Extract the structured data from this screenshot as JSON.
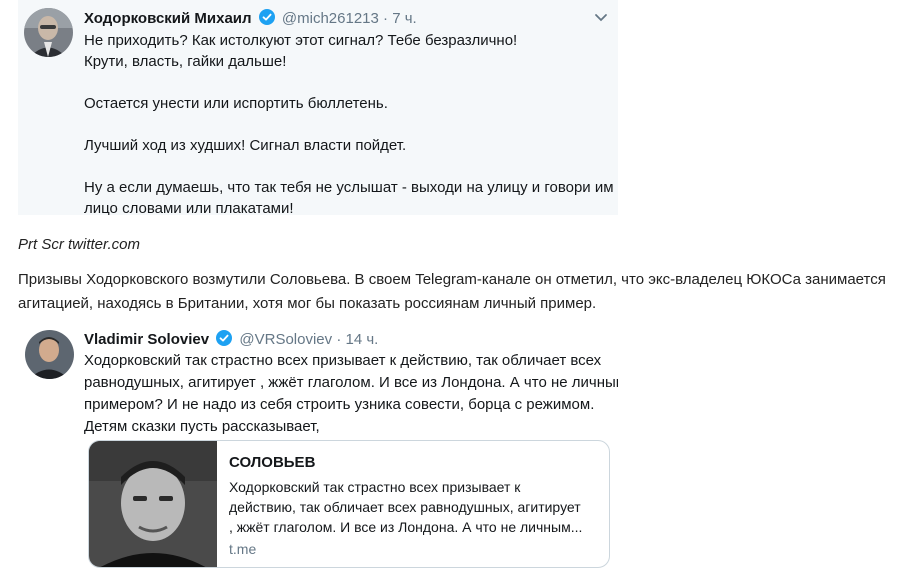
{
  "tweet1": {
    "name": "Ходорковский Михаил",
    "handle": "@mich261213",
    "dot": "·",
    "time": "7 ч.",
    "paragraphs": [
      [
        "Не приходить? Как истолкуют этот сигнал? Тебе безразлично!",
        "Крути, власть, гайки дальше!"
      ],
      [
        "Остается унести или испортить бюллетень."
      ],
      [
        "Лучший ход из худших! Сигнал власти пойдет."
      ],
      [
        "Ну а если думаешь, что так тебя не услышат - выходи на улицу и говори им в",
        "лицо словами или плакатами!"
      ]
    ]
  },
  "caption": "Prt Scr twitter.com",
  "article": [
    "Призывы Ходорковского возмутили Соловьева. В своем Telegram-канале он отметил, что экс-владелец ЮКОСа занимается",
    "агитацией, находясь в Британии, хотя мог бы показать россиянам личный пример."
  ],
  "tweet2": {
    "name": "Vladimir Soloviev",
    "handle": "@VRSoloviev",
    "dot": "·",
    "time": "14 ч.",
    "lines": [
      "Ходорковский так страстно всех призывает к действию, так обличает всех",
      "равнодушных, агитирует , жжёт глаголом. И все из Лондона. А что не личным",
      "примером? И не надо из себя строить узника совести, борца с режимом.",
      "Детям сказки пусть рассказывает,"
    ],
    "card": {
      "title": "СОЛОВЬЕВ",
      "desc": [
        "Ходорковский так страстно всех призывает к",
        "действию, так обличает всех равнодушных, агитирует",
        ", жжёт глаголом. И все из Лондона. А что не личным..."
      ],
      "domain": "t.me"
    }
  },
  "colors": {
    "verified": "#1da1f2",
    "muted": "#657786",
    "tweet_bg": "#f5f8fa"
  },
  "icons": {
    "verified": "verified-badge-icon",
    "caret": "chevron-down-icon"
  }
}
